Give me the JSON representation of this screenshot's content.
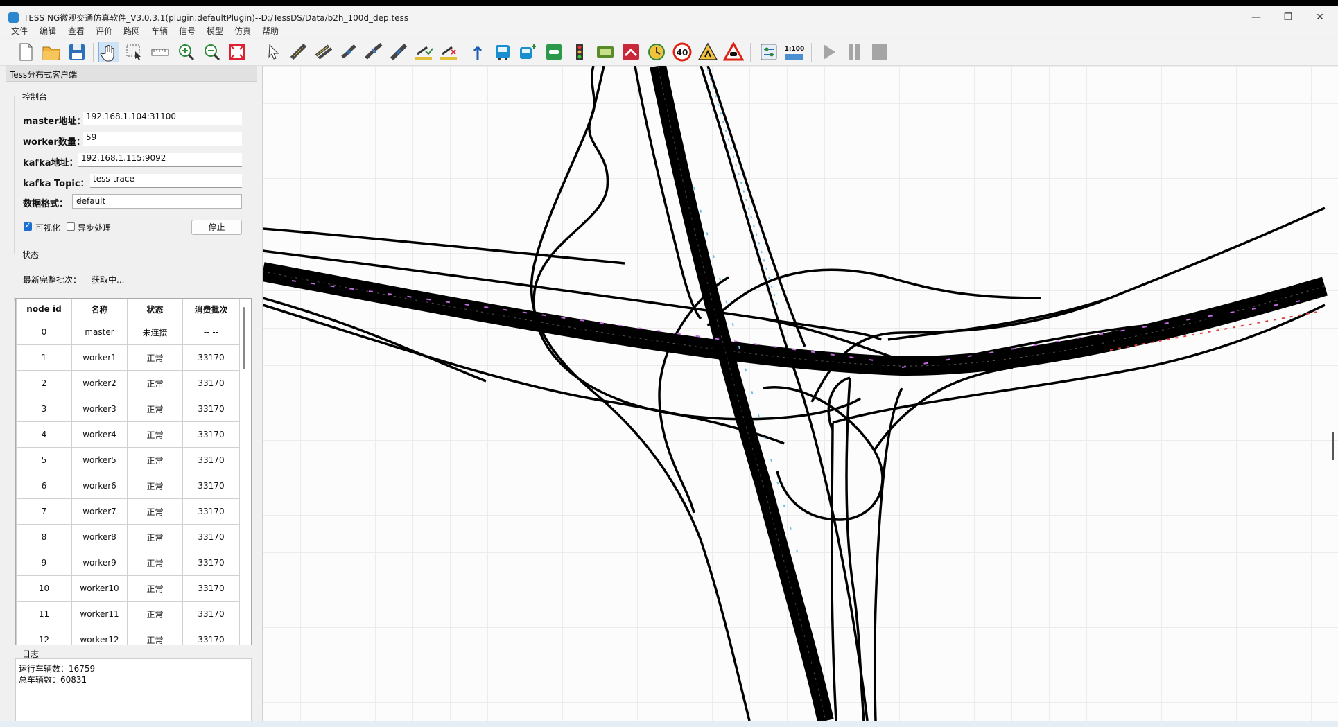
{
  "window": {
    "title": "TESS NG微观交通仿真软件_V3.0.3.1(plugin:defaultPlugin)--D:/TessDS/Data/b2h_100d_dep.tess",
    "controls": [
      "—",
      "❐",
      "✕"
    ]
  },
  "menubar": [
    "文件",
    "编辑",
    "查看",
    "评价",
    "路网",
    "车辆",
    "信号",
    "模型",
    "仿真",
    "帮助"
  ],
  "toolbar": {
    "scale_label": "1:100",
    "speed_sign": "40",
    "icons": [
      "new-file-icon",
      "open-folder-icon",
      "save-icon",
      "pan-hand-icon",
      "select-region-icon",
      "measure-ruler-icon",
      "zoom-in-icon",
      "zoom-out-icon",
      "fit-view-icon",
      "pointer-icon",
      "draw-link-icon",
      "draw-connector-icon",
      "edit-link-icon",
      "split-link-icon",
      "link-break-icon",
      "lane-marking-icon",
      "remove-marking-icon",
      "route-decision-icon",
      "bus-line-icon",
      "bus-stop-icon",
      "parking-icon",
      "traffic-signal-icon",
      "detector-icon",
      "vehicle-input-icon",
      "travel-time-icon",
      "speed-limit-icon",
      "roadwork-icon",
      "accident-icon",
      "settings-panel-icon",
      "scale-icon",
      "play-icon",
      "pause-icon",
      "stop-icon"
    ]
  },
  "panel": {
    "header": "Tess分布式客户端",
    "console": {
      "title": "控制台",
      "master_label": "master地址：",
      "master_value": "192.168.1.104:31100",
      "worker_label": "worker数量：",
      "worker_value": "59",
      "kafka_label": "kafka地址：",
      "kafka_value": "192.168.1.115:9092",
      "topic_label": "kafka Topic：",
      "topic_value": "tess-trace",
      "format_label": "数据格式：",
      "format_value": "default",
      "visualize_label": "可视化",
      "visualize_checked": true,
      "async_label": "异步处理",
      "async_checked": false,
      "stop_button": "停止"
    },
    "status": {
      "title": "状态",
      "batch_label": "最新完整批次：",
      "batch_value": "获取中..."
    },
    "table": {
      "headers": [
        "node id",
        "名称",
        "状态",
        "消费批次"
      ],
      "rows": [
        [
          "0",
          "master",
          "未连接",
          "-- --"
        ],
        [
          "1",
          "worker1",
          "正常",
          "33170"
        ],
        [
          "2",
          "worker2",
          "正常",
          "33170"
        ],
        [
          "3",
          "worker3",
          "正常",
          "33170"
        ],
        [
          "4",
          "worker4",
          "正常",
          "33170"
        ],
        [
          "5",
          "worker5",
          "正常",
          "33170"
        ],
        [
          "6",
          "worker6",
          "正常",
          "33170"
        ],
        [
          "7",
          "worker7",
          "正常",
          "33170"
        ],
        [
          "8",
          "worker8",
          "正常",
          "33170"
        ],
        [
          "9",
          "worker9",
          "正常",
          "33170"
        ],
        [
          "10",
          "worker10",
          "正常",
          "33170"
        ],
        [
          "11",
          "worker11",
          "正常",
          "33170"
        ],
        [
          "12",
          "worker12",
          "正常",
          "33170"
        ]
      ]
    },
    "log": {
      "title": "日志",
      "lines": [
        "运行车辆数：16759",
        "总车辆数：60831"
      ]
    }
  }
}
